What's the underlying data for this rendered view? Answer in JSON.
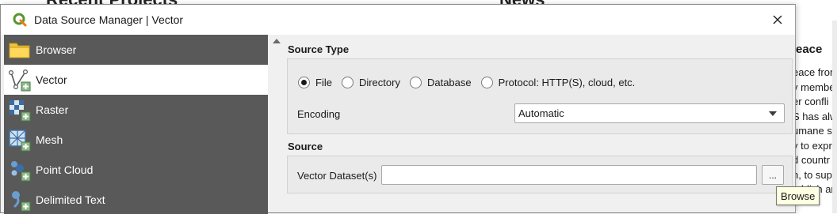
{
  "background": {
    "recent_projects_heading": "Recent Projects",
    "news_heading": "News",
    "news_title_fragment": "eace",
    "news_lines": [
      "eace from",
      "y member",
      "er confli",
      "S has alw",
      "umane sc",
      "y to expr",
      "d countr",
      "n, to sup",
      "tablish ar",
      "ı"
    ]
  },
  "dialog": {
    "title": "Data Source Manager | Vector",
    "close_glyph": "✕"
  },
  "nav": {
    "items": [
      {
        "label": "Browser",
        "icon": "folder-icon"
      },
      {
        "label": "Vector",
        "icon": "vector-layer-icon",
        "selected": true
      },
      {
        "label": "Raster",
        "icon": "raster-layer-icon"
      },
      {
        "label": "Mesh",
        "icon": "mesh-layer-icon"
      },
      {
        "label": "Point Cloud",
        "icon": "point-cloud-icon"
      },
      {
        "label": "Delimited Text",
        "icon": "delimited-text-icon"
      }
    ]
  },
  "source_type": {
    "heading": "Source Type",
    "options": [
      {
        "label": "File",
        "checked": true
      },
      {
        "label": "Directory",
        "checked": false
      },
      {
        "label": "Database",
        "checked": false
      },
      {
        "label": "Protocol: HTTP(S), cloud, etc.",
        "checked": false
      }
    ],
    "encoding_label": "Encoding",
    "encoding_value": "Automatic"
  },
  "source": {
    "heading": "Source",
    "dataset_label": "Vector Dataset(s)",
    "dataset_value": "",
    "browse_button": "...",
    "tooltip": "Browse"
  },
  "colors": {
    "nav_background": "#595959",
    "nav_selected": "#ffffff",
    "dialog_background": "#f0f0f0",
    "group_background": "#eaeaea",
    "tooltip_background": "#ffffe1",
    "qgis_green": "#589632"
  }
}
